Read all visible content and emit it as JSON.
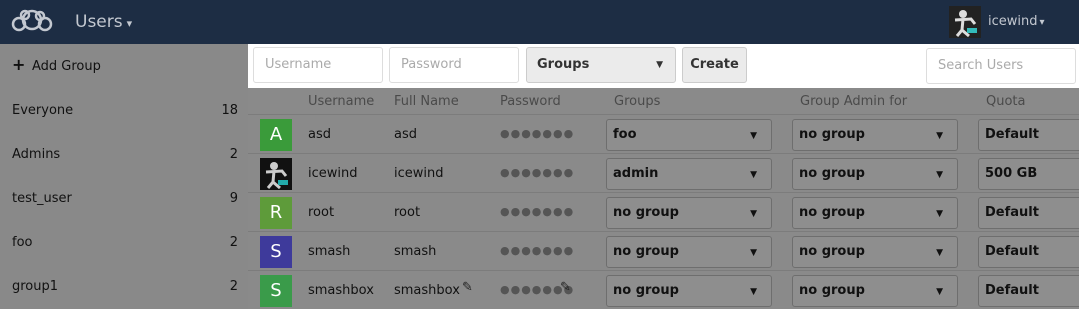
{
  "header": {
    "app_title": "Users",
    "user_name": "icewind",
    "caret": "▾"
  },
  "sidebar": {
    "add_group_label": "Add Group",
    "groups": [
      {
        "label": "Everyone",
        "count": "18"
      },
      {
        "label": "Admins",
        "count": "2"
      },
      {
        "label": "test_user",
        "count": "9"
      },
      {
        "label": "foo",
        "count": "2"
      },
      {
        "label": "group1",
        "count": "2"
      }
    ]
  },
  "controls": {
    "username_placeholder": "Username",
    "password_placeholder": "Password",
    "groups_label": "Groups",
    "create_label": "Create",
    "search_placeholder": "Search Users"
  },
  "table": {
    "headers": [
      "Username",
      "Full Name",
      "Password",
      "Groups",
      "Group Admin for",
      "Quota"
    ],
    "rows": [
      {
        "avatar": "A",
        "avatar_color": "#3a9b3a",
        "username": "asd",
        "full_name": "asd",
        "password": "●●●●●●●",
        "groups": "foo",
        "group_admin": "no group",
        "quota": "Default"
      },
      {
        "avatar": "",
        "avatar_color": "#111111",
        "username": "icewind",
        "full_name": "icewind",
        "password": "●●●●●●●",
        "groups": "admin",
        "group_admin": "no group",
        "quota": "500 GB"
      },
      {
        "avatar": "R",
        "avatar_color": "#5e9b3a",
        "username": "root",
        "full_name": "root",
        "password": "●●●●●●●",
        "groups": "no group",
        "group_admin": "no group",
        "quota": "Default"
      },
      {
        "avatar": "S",
        "avatar_color": "#3e3a9b",
        "username": "smash",
        "full_name": "smash",
        "password": "●●●●●●●",
        "groups": "no group",
        "group_admin": "no group",
        "quota": "Default"
      },
      {
        "avatar": "S",
        "avatar_color": "#3a9b4a",
        "username": "smashbox",
        "full_name": "smashbox",
        "password": "●●●●●●●",
        "groups": "no group",
        "group_admin": "no group",
        "quota": "Default"
      }
    ]
  },
  "colors": {
    "header_bg": "#1d2d44",
    "overlay_bg": "#8a8a8a"
  }
}
